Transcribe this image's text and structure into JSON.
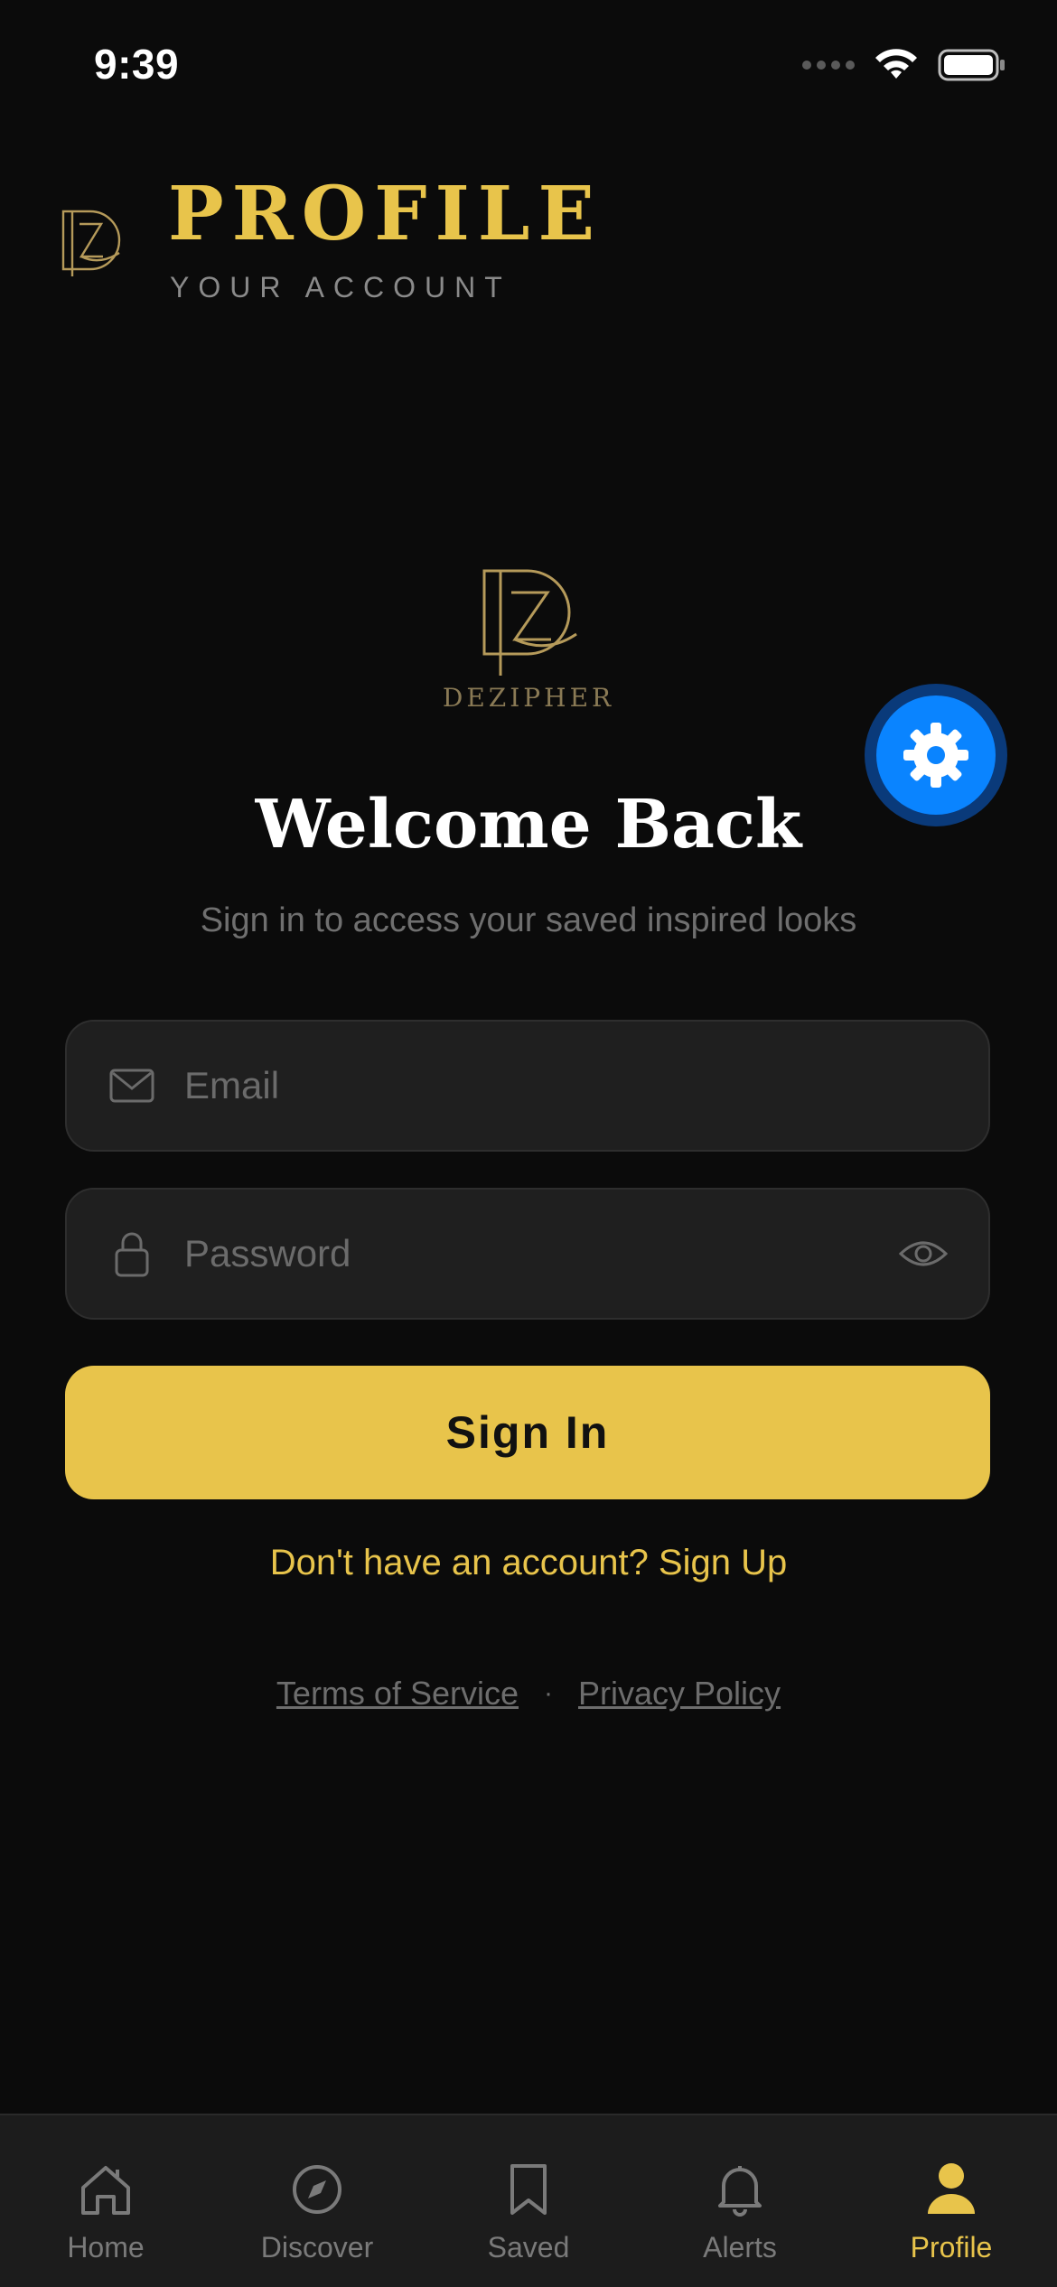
{
  "status_bar": {
    "time": "9:39"
  },
  "header": {
    "title": "PROFILE",
    "subtitle": "YOUR ACCOUNT",
    "logo_icon": "dz-monogram-icon"
  },
  "brand": {
    "name": "DEZIPHER",
    "logo_icon": "dz-monogram-icon"
  },
  "settings_fab": {
    "icon": "gear-icon"
  },
  "welcome": {
    "title": "Welcome Back",
    "subtitle": "Sign in to access your saved inspired looks"
  },
  "form": {
    "email": {
      "value": "",
      "placeholder": "Email",
      "icon": "mail-icon"
    },
    "password": {
      "value": "",
      "placeholder": "Password",
      "icon": "lock-icon",
      "toggle_icon": "eye-icon"
    },
    "submit_label": "Sign In",
    "signup_text": "Don't have an account? Sign Up"
  },
  "legal": {
    "terms": "Terms of Service",
    "separator": "·",
    "privacy": "Privacy Policy"
  },
  "tabbar": {
    "items": [
      {
        "label": "Home",
        "icon": "home-icon",
        "active": false
      },
      {
        "label": "Discover",
        "icon": "compass-icon",
        "active": false
      },
      {
        "label": "Saved",
        "icon": "bookmark-icon",
        "active": false
      },
      {
        "label": "Alerts",
        "icon": "bell-icon",
        "active": false
      },
      {
        "label": "Profile",
        "icon": "person-icon",
        "active": true
      }
    ]
  },
  "colors": {
    "background": "#0b0b0b",
    "accent": "#e8c44b",
    "field_bg": "#1f1f1f",
    "fab_blue": "#0a84ff",
    "tabbar_bg": "#1c1c1c"
  }
}
